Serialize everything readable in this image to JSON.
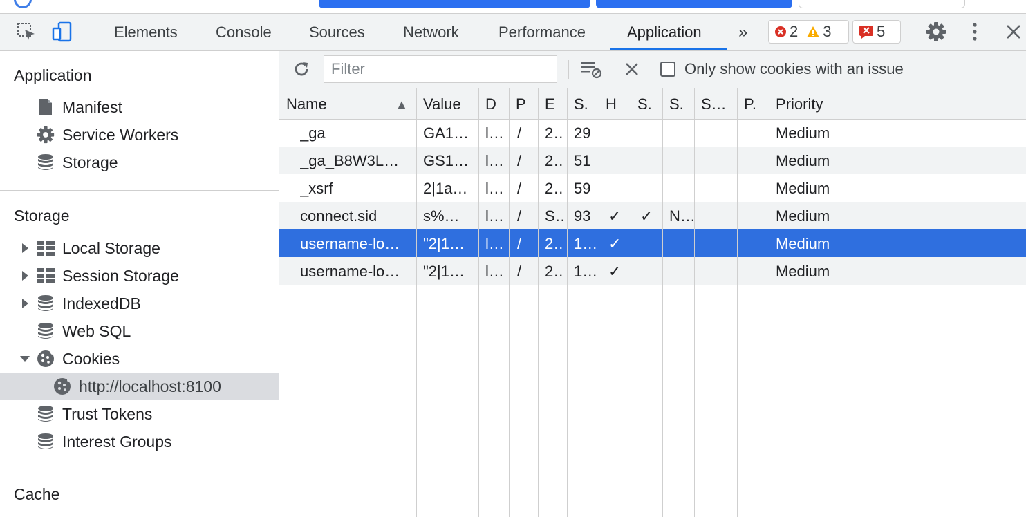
{
  "toolbar": {
    "tabs": [
      "Elements",
      "Console",
      "Sources",
      "Network",
      "Performance",
      "Application"
    ],
    "overflow_glyph": "»",
    "errors_count": "2",
    "warnings_count": "3",
    "issues_count": "5"
  },
  "sidebar": {
    "application_heading": "Application",
    "application_items": [
      "Manifest",
      "Service Workers",
      "Storage"
    ],
    "storage_heading": "Storage",
    "storage_items": [
      "Local Storage",
      "Session Storage",
      "IndexedDB",
      "Web SQL",
      "Cookies",
      "http://localhost:8100",
      "Trust Tokens",
      "Interest Groups"
    ],
    "cache_heading": "Cache"
  },
  "filterbar": {
    "filter_placeholder": "Filter",
    "only_issues_label": "Only show cookies with an issue"
  },
  "table": {
    "columns": [
      "Name",
      "Value",
      "D",
      "P",
      "E",
      "S.",
      "H",
      "S.",
      "S.",
      "S…",
      "P.",
      "Priority"
    ],
    "sort_indicator": "▲",
    "rows": [
      [
        "_ga",
        "GA1…",
        "l…",
        "/",
        "2…",
        "29",
        "",
        "",
        "",
        "",
        "",
        "Medium"
      ],
      [
        "_ga_B8W3L…",
        "GS1…",
        "l…",
        "/",
        "2…",
        "51",
        "",
        "",
        "",
        "",
        "",
        "Medium"
      ],
      [
        "_xsrf",
        "2|1a…",
        "l…",
        "/",
        "2…",
        "59",
        "",
        "",
        "",
        "",
        "",
        "Medium"
      ],
      [
        "connect.sid",
        "s%…",
        "l…",
        "/",
        "S…",
        "93",
        "✓",
        "✓",
        "N…",
        "",
        "",
        "Medium"
      ],
      [
        "username-lo…",
        "\"2|1…",
        "l…",
        "/",
        "2…",
        "1…",
        "✓",
        "",
        "",
        "",
        "",
        "Medium"
      ],
      [
        "username-lo…",
        "\"2|1…",
        "l…",
        "/",
        "2…",
        "1…",
        "✓",
        "",
        "",
        "",
        "",
        "Medium"
      ]
    ],
    "selected_row": 4
  },
  "colors": {
    "accent": "#1a73e8",
    "selected_row": "#2f6fdf",
    "error": "#d93025",
    "warning": "#f9ab00"
  }
}
